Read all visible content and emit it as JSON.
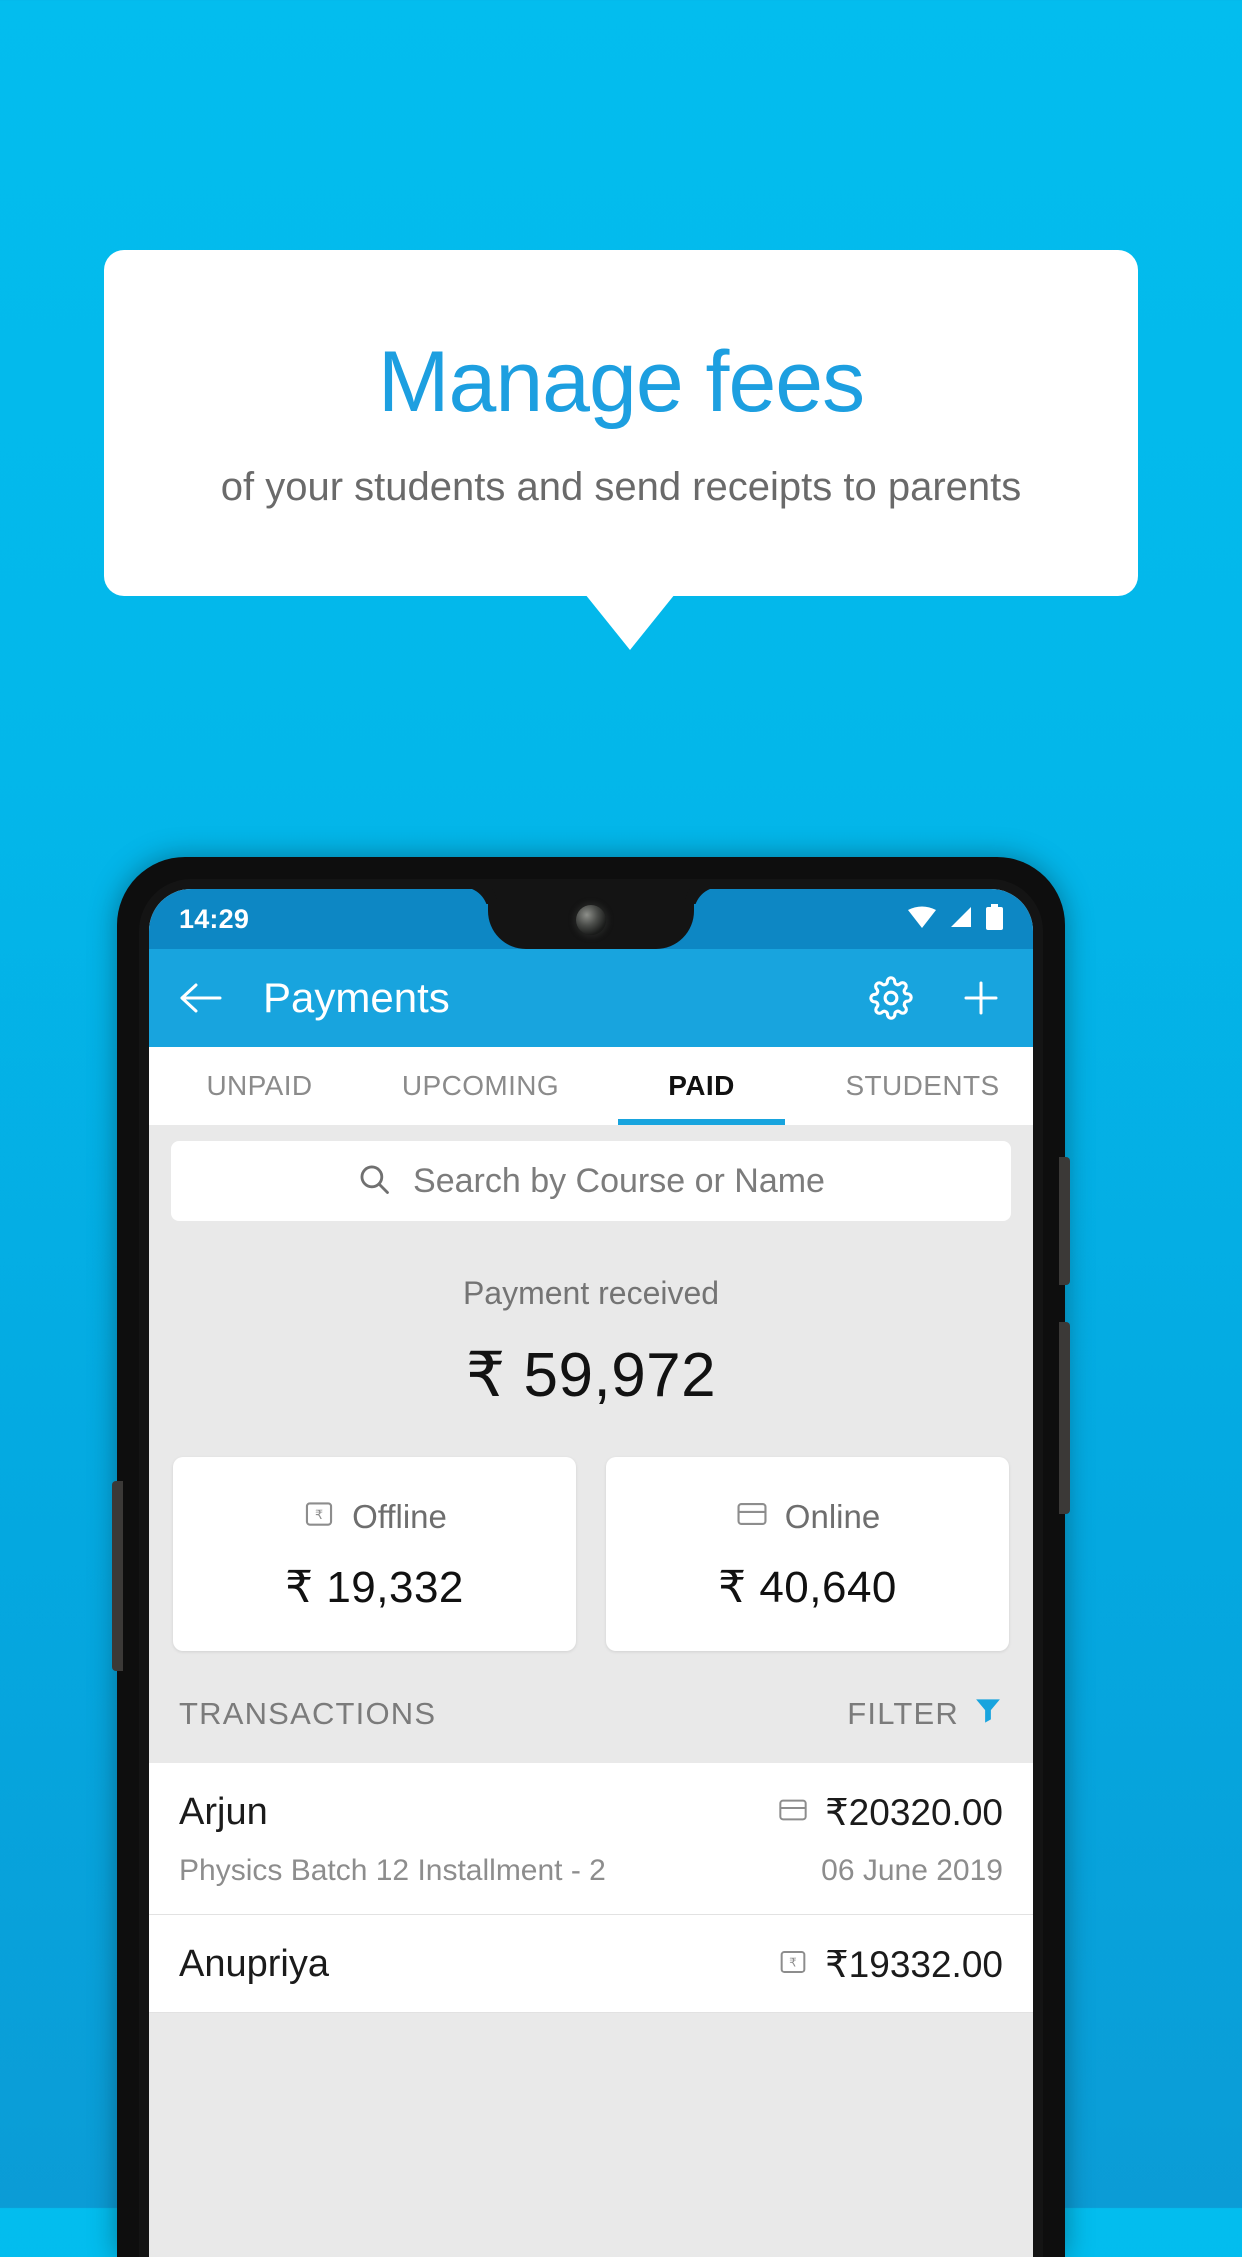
{
  "promo": {
    "title": "Manage fees",
    "subtitle": "of your students and send receipts to parents",
    "title_color": "#1d9fe0",
    "background_color": "#03bdee"
  },
  "phone": {
    "statusbar": {
      "time": "14:29",
      "icons": [
        "wifi-icon",
        "signal-icon",
        "battery-icon"
      ]
    },
    "appbar": {
      "back_icon": "back-arrow-icon",
      "title": "Payments",
      "settings_icon": "gear-icon",
      "add_icon": "plus-icon",
      "color": "#18a4de"
    },
    "tabs": [
      {
        "label": "UNPAID",
        "active": false
      },
      {
        "label": "UPCOMING",
        "active": false
      },
      {
        "label": "PAID",
        "active": true
      },
      {
        "label": "STUDENTS",
        "active": false
      }
    ],
    "search": {
      "icon": "search-icon",
      "placeholder": "Search by Course or Name"
    },
    "summary": {
      "label": "Payment received",
      "amount": "₹ 59,972"
    },
    "breakdown": [
      {
        "icon": "rupee-note-icon",
        "label": "Offline",
        "amount": "₹ 19,332"
      },
      {
        "icon": "credit-card-icon",
        "label": "Online",
        "amount": "₹ 40,640"
      }
    ],
    "transactions_header": {
      "title": "TRANSACTIONS",
      "filter_label": "FILTER",
      "filter_icon": "funnel-icon",
      "filter_color": "#18a4de"
    },
    "transactions": [
      {
        "name": "Arjun",
        "description": "Physics Batch 12 Installment - 2",
        "amount": "₹20320.00",
        "date": "06 June 2019",
        "method_icon": "credit-card-icon"
      },
      {
        "name": "Anupriya",
        "description": "",
        "amount": "₹19332.00",
        "date": "",
        "method_icon": "rupee-note-icon"
      }
    ]
  }
}
